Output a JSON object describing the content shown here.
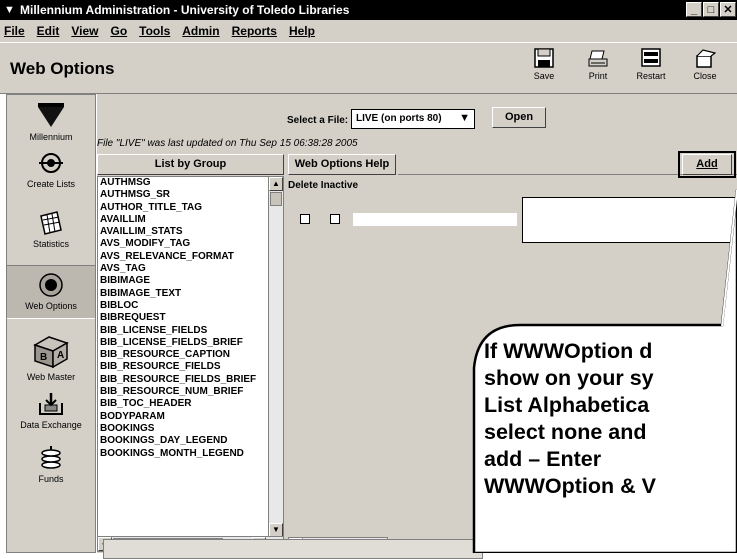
{
  "window": {
    "title": "Millennium Administration - University of Toledo Libraries",
    "controls": [
      "_",
      "□",
      "✕"
    ]
  },
  "menu": [
    "File",
    "Edit",
    "View",
    "Go",
    "Tools",
    "Admin",
    "Reports",
    "Help"
  ],
  "header": {
    "title": "Web Options",
    "toolbar": [
      {
        "label": "Save",
        "icon": "save-icon"
      },
      {
        "label": "Print",
        "icon": "print-icon"
      },
      {
        "label": "Restart",
        "icon": "restart-icon"
      },
      {
        "label": "Close",
        "icon": "close-icon"
      }
    ]
  },
  "sidebar": {
    "items": [
      {
        "label": "Millennium",
        "icon": "millennium-icon"
      },
      {
        "label": "Create Lists",
        "icon": "create-lists-icon"
      },
      {
        "label": "Statistics",
        "icon": "statistics-icon"
      },
      {
        "label": "Web Options",
        "icon": "web-options-icon",
        "active": true
      },
      {
        "label": "Web Master",
        "icon": "web-master-icon"
      },
      {
        "label": "Data Exchange",
        "icon": "data-exchange-icon"
      },
      {
        "label": "Funds",
        "icon": "funds-icon"
      }
    ]
  },
  "file_select": {
    "label": "Select a File:",
    "value": "LIVE (on ports 80)",
    "open_label": "Open"
  },
  "updated_text": "File \"LIVE\" was last updated on Thu Sep 15 06:38:28 2005",
  "list": {
    "tab_label": "List by Group",
    "items": [
      "AUTHMSG",
      "AUTHMSG_SR",
      "AUTHOR_TITLE_TAG",
      "AVAILLIM",
      "AVAILLIM_STATS",
      "AVS_MODIFY_TAG",
      "AVS_RELEVANCE_FORMAT",
      "AVS_TAG",
      "BIBIMAGE",
      "BIBIMAGE_TEXT",
      "BIBLOC",
      "BIBREQUEST",
      "BIB_LICENSE_FIELDS",
      "BIB_LICENSE_FIELDS_BRIEF",
      "BIB_RESOURCE_CAPTION",
      "BIB_RESOURCE_FIELDS",
      "BIB_RESOURCE_FIELDS_BRIEF",
      "BIB_RESOURCE_NUM_BRIEF",
      "BIB_TOC_HEADER",
      "BODYPARAM",
      "BOOKINGS",
      "BOOKINGS_DAY_LEGEND",
      "BOOKINGS_MONTH_LEGEND"
    ]
  },
  "right": {
    "help_tab": "Web Options Help",
    "add_label": "Add",
    "delete_inactive": "Delete Inactive"
  },
  "callout": {
    "lines": [
      "If WWWOption d",
      "show on your sy",
      "List Alphabetica",
      "select none and",
      "add – Enter",
      "WWWOption & V"
    ]
  }
}
